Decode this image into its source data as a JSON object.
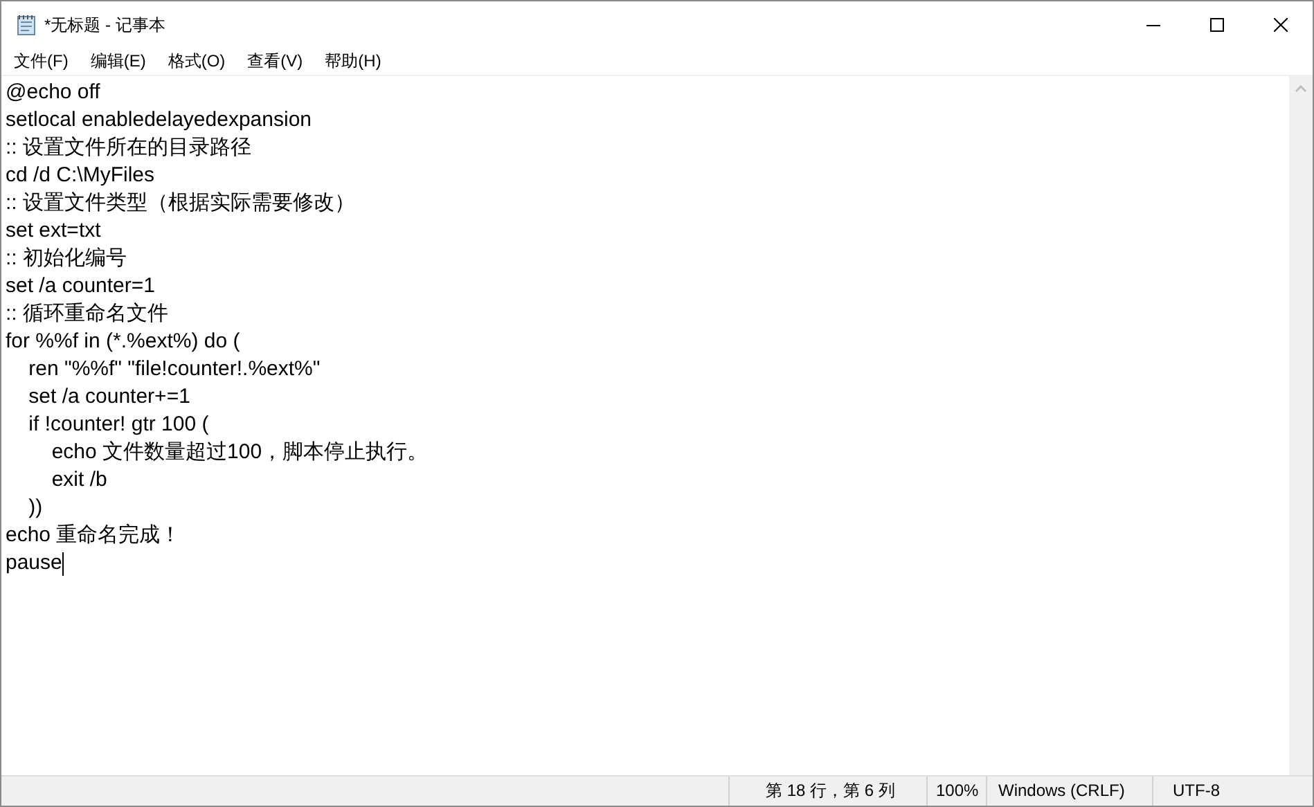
{
  "window": {
    "title": "*无标题 - 记事本"
  },
  "menu": [
    "文件(F)",
    "编辑(E)",
    "格式(O)",
    "查看(V)",
    "帮助(H)"
  ],
  "editor": {
    "lines": [
      {
        "text": "@echo off",
        "caret": false
      },
      {
        "text": "setlocal enabledelayedexpansion",
        "caret": false
      },
      {
        "text": ":: 设置文件所在的目录路径",
        "caret": false
      },
      {
        "text": "cd /d C:\\MyFiles",
        "caret": false
      },
      {
        "text": ":: 设置文件类型（根据实际需要修改）",
        "caret": false
      },
      {
        "text": "set ext=txt",
        "caret": false
      },
      {
        "text": ":: 初始化编号",
        "caret": false
      },
      {
        "text": "set /a counter=1",
        "caret": false
      },
      {
        "text": ":: 循环重命名文件",
        "caret": false
      },
      {
        "text": "for %%f in (*.%ext%) do (",
        "caret": false
      },
      {
        "text": "    ren \"%%f\" \"file!counter!.%ext%\"",
        "caret": false
      },
      {
        "text": "    set /a counter+=1",
        "caret": false
      },
      {
        "text": "    if !counter! gtr 100 (",
        "caret": false
      },
      {
        "text": "        echo 文件数量超过100，脚本停止执行。",
        "caret": false
      },
      {
        "text": "        exit /b",
        "caret": false
      },
      {
        "text": "    ))",
        "caret": false
      },
      {
        "text": "echo 重命名完成！",
        "caret": false
      },
      {
        "text": "pause",
        "caret": true
      }
    ]
  },
  "status_bar": [
    "第 18 行，第 6 列",
    "100%",
    "Windows (CRLF)",
    "UTF-8"
  ]
}
